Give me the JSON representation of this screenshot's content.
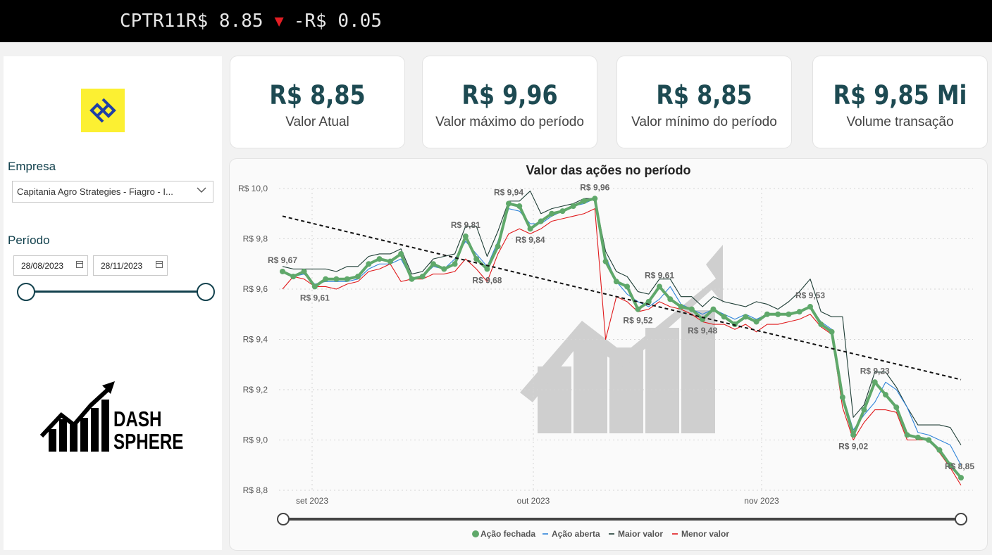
{
  "ticker": {
    "symbol": "CPTR11",
    "price": "R$ 8.85",
    "direction_icon": "down-triangle-icon",
    "change": "-R$ 0.05"
  },
  "sidebar": {
    "company_label": "Empresa",
    "company_value": "Capitania Agro Strategies - Fiagro - I...",
    "period_label": "Período",
    "date_start": "28/08/2023",
    "date_end": "28/11/2023",
    "slider_range": [
      0,
      1
    ],
    "brand_line1": "DASH",
    "brand_line2": "SPHERE"
  },
  "kpis": [
    {
      "value": "R$ 8,85",
      "label": "Valor Atual"
    },
    {
      "value": "R$ 9,96",
      "label": "Valor máximo do período"
    },
    {
      "value": "R$ 8,85",
      "label": "Valor mínimo do período"
    },
    {
      "value": "R$ 9,85 Mi",
      "label": "Volume transação"
    }
  ],
  "colors": {
    "accent": "#12414d",
    "kpi_value": "#1d4a52",
    "ticker_down": "#e31e24",
    "close": "#5fa86a",
    "open": "#2f83d9",
    "high": "#1d3c34",
    "low": "#e0191b",
    "trend": "#111111"
  },
  "chart_data": {
    "type": "line",
    "title": "Valor das ações no período",
    "y_ticks": [
      "R$ 10,0",
      "R$ 9,8",
      "R$ 9,6",
      "R$ 9,4",
      "R$ 9,2",
      "R$ 9,0",
      "R$ 8,8"
    ],
    "ylim": [
      8.8,
      10.0
    ],
    "x_ticks": [
      "set 2023",
      "out 2023",
      "nov 2023"
    ],
    "grid": true,
    "legend_position": "bottom",
    "legend": [
      "Ação fechada",
      "Ação aberta",
      "Maior valor",
      "Menor valor"
    ],
    "x": [
      1,
      2,
      3,
      4,
      5,
      6,
      7,
      8,
      9,
      10,
      11,
      12,
      13,
      14,
      15,
      16,
      17,
      18,
      19,
      20,
      21,
      22,
      23,
      24,
      25,
      26,
      27,
      28,
      29,
      30,
      31,
      32,
      33,
      34,
      35,
      36,
      37,
      38,
      39,
      40,
      41,
      42,
      43,
      44,
      45,
      46,
      47,
      48,
      49,
      50,
      51,
      52,
      53,
      54,
      55,
      56,
      57,
      58,
      59,
      60,
      61,
      62,
      63,
      64
    ],
    "series": [
      {
        "name": "Ação fechada",
        "values": [
          9.67,
          9.65,
          9.67,
          9.61,
          9.64,
          9.64,
          9.64,
          9.65,
          9.7,
          9.72,
          9.71,
          9.74,
          9.64,
          9.65,
          9.7,
          9.68,
          9.7,
          9.81,
          9.72,
          9.68,
          9.77,
          9.94,
          9.93,
          9.84,
          9.87,
          9.9,
          9.91,
          9.93,
          9.95,
          9.96,
          9.71,
          9.63,
          9.61,
          9.52,
          9.55,
          9.61,
          9.56,
          9.53,
          9.52,
          9.48,
          9.52,
          9.49,
          9.46,
          9.49,
          9.47,
          9.5,
          9.5,
          9.5,
          9.51,
          9.53,
          9.46,
          9.43,
          9.17,
          9.02,
          9.12,
          9.23,
          9.18,
          9.13,
          9.02,
          9.01,
          9.0,
          8.96,
          8.9,
          8.85
        ]
      },
      {
        "name": "Ação aberta",
        "values": [
          9.67,
          9.65,
          9.66,
          9.62,
          9.63,
          9.63,
          9.63,
          9.64,
          9.68,
          9.7,
          9.7,
          9.72,
          9.64,
          9.65,
          9.69,
          9.68,
          9.72,
          9.79,
          9.74,
          9.69,
          9.79,
          9.92,
          9.91,
          9.86,
          9.86,
          9.89,
          9.91,
          9.93,
          9.94,
          9.96,
          9.73,
          9.63,
          9.58,
          9.55,
          9.53,
          9.56,
          9.61,
          9.54,
          9.52,
          9.5,
          9.52,
          9.5,
          9.48,
          9.5,
          9.48,
          9.5,
          9.5,
          9.5,
          9.51,
          9.53,
          9.47,
          9.44,
          9.18,
          9.04,
          9.1,
          9.15,
          9.23,
          9.2,
          9.13,
          9.03,
          9.02,
          9.0,
          8.98,
          8.9
        ]
      },
      {
        "name": "Maior valor",
        "values": [
          9.69,
          9.68,
          9.68,
          9.68,
          9.68,
          9.67,
          9.69,
          9.69,
          9.73,
          9.74,
          9.74,
          9.76,
          9.66,
          9.67,
          9.72,
          9.73,
          9.74,
          9.85,
          9.85,
          9.73,
          9.83,
          9.95,
          9.95,
          9.99,
          9.9,
          9.92,
          9.93,
          9.94,
          9.96,
          9.96,
          9.75,
          9.67,
          9.65,
          9.59,
          9.58,
          9.64,
          9.64,
          9.57,
          9.57,
          9.53,
          9.57,
          9.55,
          9.54,
          9.53,
          9.55,
          9.54,
          9.52,
          9.55,
          9.59,
          9.64,
          9.51,
          9.49,
          9.49,
          9.09,
          9.14,
          9.27,
          9.27,
          9.21,
          9.13,
          9.06,
          9.06,
          9.06,
          9.05,
          8.98
        ]
      },
      {
        "name": "Menor valor",
        "values": [
          9.6,
          9.65,
          9.64,
          9.61,
          9.61,
          9.6,
          9.62,
          9.63,
          9.67,
          9.68,
          9.7,
          9.63,
          9.64,
          9.64,
          9.66,
          9.66,
          9.67,
          9.72,
          9.68,
          9.63,
          9.74,
          9.82,
          9.84,
          9.82,
          9.84,
          9.87,
          9.88,
          9.89,
          9.9,
          9.92,
          9.4,
          9.57,
          9.55,
          9.51,
          9.52,
          9.55,
          9.53,
          9.52,
          9.5,
          9.47,
          9.46,
          9.46,
          9.44,
          9.46,
          9.43,
          9.46,
          9.46,
          9.47,
          9.48,
          9.5,
          9.45,
          9.42,
          9.13,
          9.0,
          9.07,
          9.12,
          9.12,
          9.11,
          9.0,
          9.0,
          9.0,
          8.95,
          8.89,
          8.82
        ]
      }
    ],
    "trendline": {
      "start": 9.89,
      "end": 9.24
    },
    "annotations": [
      {
        "point": 1,
        "text": "R$ 9,67"
      },
      {
        "point": 4,
        "text": "R$ 9,61"
      },
      {
        "point": 18,
        "text": "R$ 9,81"
      },
      {
        "point": 20,
        "text": "R$ 9,68"
      },
      {
        "point": 22,
        "text": "R$ 9,94"
      },
      {
        "point": 24,
        "text": "R$ 9,84"
      },
      {
        "point": 30,
        "text": "R$ 9,96"
      },
      {
        "point": 34,
        "text": "R$ 9,52"
      },
      {
        "point": 36,
        "text": "R$ 9,61"
      },
      {
        "point": 40,
        "text": "R$ 9,48"
      },
      {
        "point": 50,
        "text": "R$ 9,53"
      },
      {
        "point": 54,
        "text": "R$ 9,02"
      },
      {
        "point": 56,
        "text": "R$ 9,23"
      },
      {
        "point": 64,
        "text": "R$ 8,85"
      }
    ]
  }
}
